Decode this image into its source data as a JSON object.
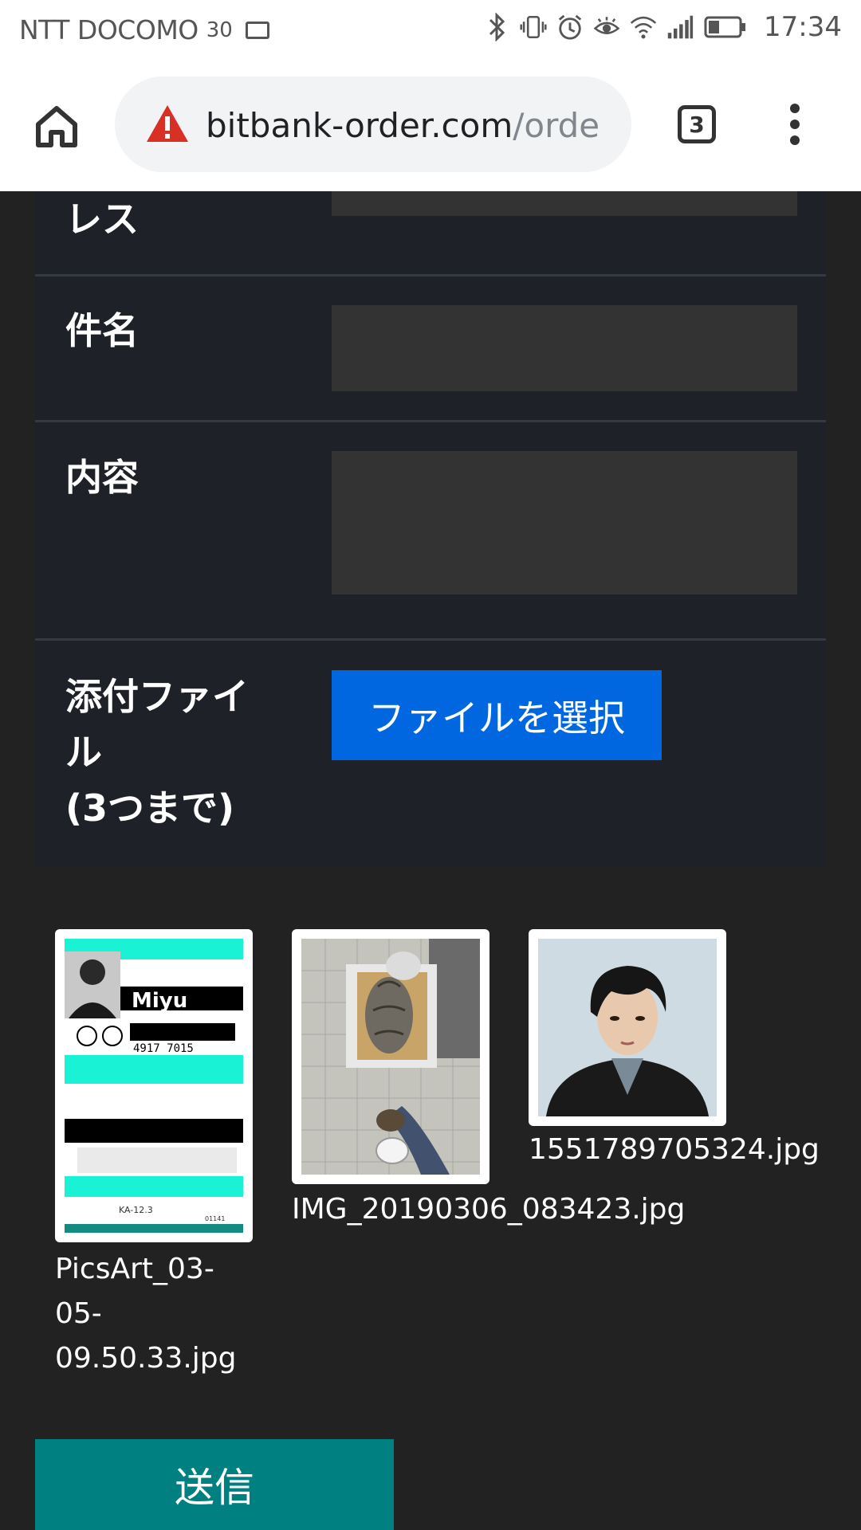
{
  "status_bar": {
    "carrier": "NTT DOCOMO",
    "carrier_extra": "30",
    "time": "17:34"
  },
  "browser": {
    "url_domain": "bitbank-order.com",
    "url_path": "/orde",
    "tab_count": "3"
  },
  "form": {
    "address_label_fragment": "レス",
    "subject_label": "件名",
    "content_label": "内容",
    "attachment_label_line1": "添付ファイ",
    "attachment_label_line2": "ル",
    "attachment_label_line3": "(3つまで)",
    "file_button_label": "ファイルを選択"
  },
  "attachments": [
    {
      "caption_lines": [
        "PicsArt_03-",
        "05-",
        "09.50.33.jpg"
      ],
      "image_text": "Miyu",
      "barcode_number": "4917 7015",
      "code_label": "KA-12.3",
      "code_number": "01141"
    },
    {
      "caption_lines": [
        "IMG_20190306_083423.jpg"
      ]
    },
    {
      "caption_lines": [
        "1551789705324.jpg"
      ]
    }
  ],
  "submit_label": "送信",
  "colors": {
    "page_bg": "#222222",
    "panel_bg": "#1e2127",
    "field_bg": "#333333",
    "file_button": "#0067e0",
    "submit_button": "#008080",
    "warning": "#d93025"
  }
}
